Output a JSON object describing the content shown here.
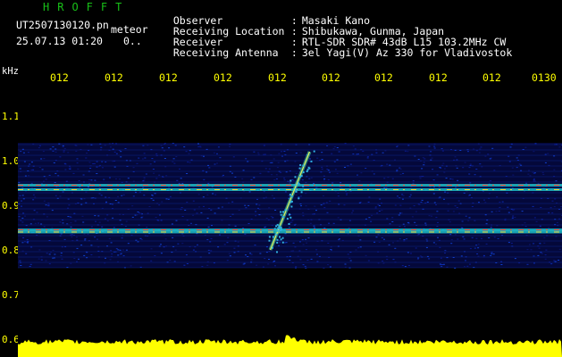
{
  "header": {
    "brand": "HROFFT",
    "filename": "UT2507130120.pn",
    "tag": "meteor",
    "datetime": "25.07.13 01:20",
    "datetime_extra": "0..",
    "metadata": [
      {
        "key": "Observer",
        "value": "Masaki Kano"
      },
      {
        "key": "Receiving Location",
        "value": "Shibukawa, Gunma, Japan"
      },
      {
        "key": "Receiver",
        "value": "RTL-SDR SDR# 43dB L15 103.2MHz CW"
      },
      {
        "key": "Receiving Antenna",
        "value": "3el Yagi(V) Az 330 for Vladivostok"
      }
    ]
  },
  "chart_data": {
    "type": "heatmap",
    "ylabel": "kHz",
    "x_ticks": [
      "012",
      "012",
      "012",
      "012",
      "012",
      "012",
      "012",
      "012",
      "012",
      "0130"
    ],
    "y_ticks": [
      "1.1",
      "1.0",
      "0.9",
      "0.8",
      "0.7",
      "0.6"
    ],
    "ylim": [
      0.6,
      1.1
    ],
    "carrier_lines_khz": [
      0.945,
      0.935,
      0.845,
      0.84
    ],
    "meteor_event": {
      "x_fraction": 0.5,
      "khz_start": 0.8,
      "khz_end": 1.02
    },
    "noise_band_khz": [
      0.76,
      1.04
    ],
    "colors": {
      "tick": "#ffff00",
      "brand": "#18c018",
      "amplitude": "#ffff00"
    }
  }
}
